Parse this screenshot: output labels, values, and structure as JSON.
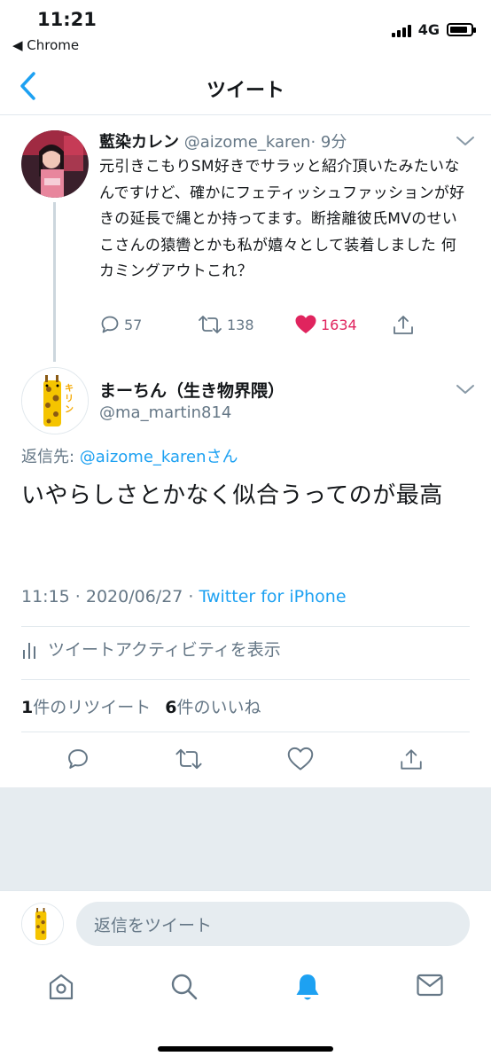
{
  "status_bar": {
    "time": "11:21",
    "back_app": "◀ Chrome",
    "network": "4G"
  },
  "header": {
    "title": "ツイート"
  },
  "tweet1": {
    "name": "藍染カレン",
    "handle": "@aizome_karen",
    "time": "· 9分",
    "text": "元引きこもりSM好きでサラッと紹介頂いたみたいなんですけど、確かにフェティッシュファッションが好きの延長で縄とか持ってます。断捨離彼氏MVのせいこさんの猿轡とかも私が嬉々として装着しました 何カミングアウトこれ？",
    "replies": "57",
    "retweets": "138",
    "likes": "1634",
    "like_color": "#e0245e"
  },
  "tweet2": {
    "name": "まーちん（生き物界隈）",
    "handle": "@ma_martin814",
    "reply_prefix": "返信先: ",
    "reply_handle": "@aizome_karen",
    "reply_suffix": "さん",
    "text": "いやらしさとかなく似合うってのが最高",
    "timestamp": "11:15 · 2020/06/27 · ",
    "source": "Twitter for iPhone",
    "activity_label": "ツイートアクティビティを表示",
    "retweet_count": "1",
    "retweet_label": "件のリツイート",
    "like_count": "6",
    "like_label": "件のいいね"
  },
  "avatar_badge_text": "キリン",
  "reply_bar": {
    "placeholder": "返信をツイート"
  },
  "colors": {
    "accent": "#1da1f2",
    "muted": "#657786",
    "band": "#e6ecf0"
  },
  "tabs": [
    "home-icon",
    "search-icon",
    "notifications-icon",
    "messages-icon"
  ]
}
